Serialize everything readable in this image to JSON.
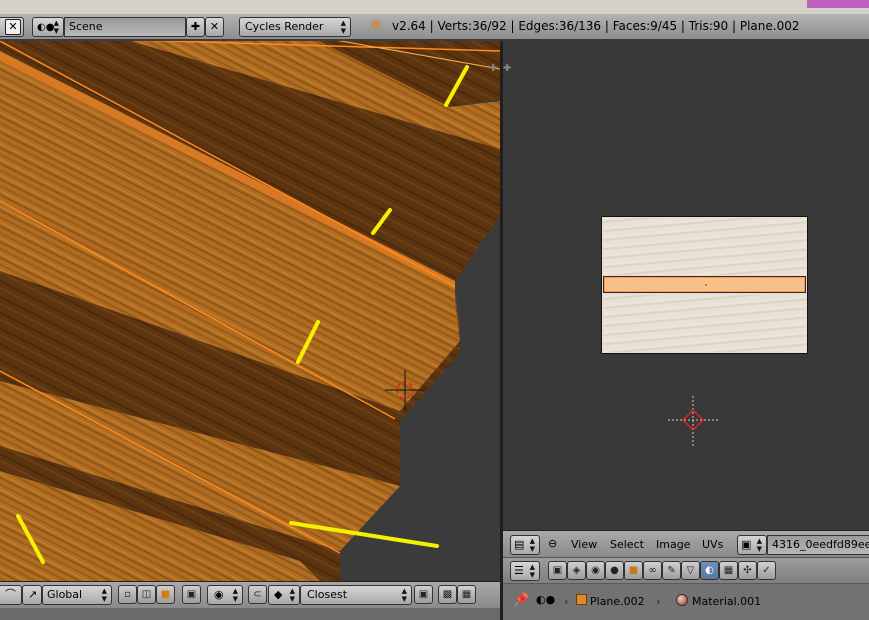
{
  "header": {
    "scene_name": "Scene",
    "render_engine": "Cycles Render",
    "stats": "v2.64 | Verts:36/92 | Edges:36/136 | Faces:9/45 | Tris:90 | Plane.002"
  },
  "image_editor": {
    "menus": [
      "View",
      "Select",
      "Image",
      "UVs"
    ],
    "image_name": "4316_0eedfd89ee."
  },
  "viewport_header": {
    "orientation": "Global",
    "snap_target": "Closest"
  },
  "properties": {
    "breadcrumb_object": "Plane.002",
    "breadcrumb_material": "Material.001",
    "active_tab": "material-icon"
  },
  "icons": {
    "render_engine": "blender-logo-icon",
    "pin": "pin-icon",
    "object": "cube-icon",
    "material": "material-sphere-icon"
  },
  "colors": {
    "wood": "#a8661e",
    "selection": "#ff8a1e",
    "annotation": "#ffff00"
  }
}
